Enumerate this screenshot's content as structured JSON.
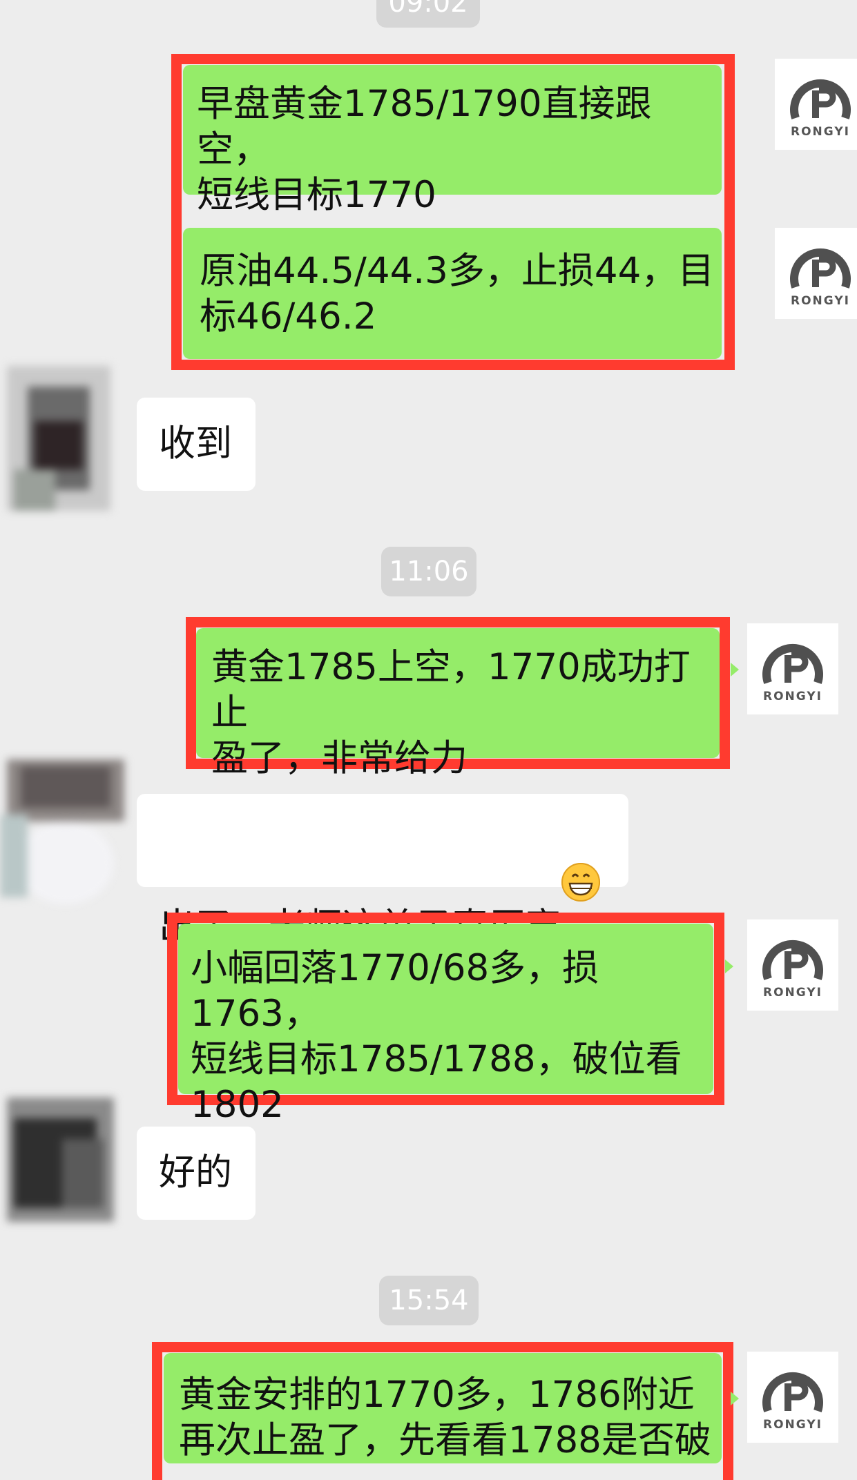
{
  "chat": {
    "timestamps": [
      "09:02",
      "11:06",
      "15:54"
    ],
    "messages": [
      {
        "from": "teacher",
        "text": "早盘黄金1785/1790直接跟空，\n短线目标1770"
      },
      {
        "from": "teacher",
        "text": "原油44.5/44.3多，止损44，目\n标46/46.2"
      },
      {
        "from": "client",
        "text": "收到"
      },
      {
        "from": "teacher",
        "text": "黄金1785上空，1770成功打止\n盈了，非常给力"
      },
      {
        "from": "client",
        "text": "出了，老师这单子真厉害"
      },
      {
        "from": "teacher",
        "text": "小幅回落1770/68多，损1763，\n短线目标1785/1788，破位看\n1802"
      },
      {
        "from": "client",
        "text": "好的"
      },
      {
        "from": "teacher",
        "text": "黄金安排的1770多，1786附近\n再次止盈了，先看看1788是否破"
      }
    ]
  },
  "avatar": {
    "logo_caption": "RONGYI",
    "logo_mark": "融亿",
    "icon": "rongyi-logo-icon"
  },
  "emoji": {
    "icon": "grinning-face-emoji"
  },
  "colors": {
    "background": "#ededed",
    "green_bubble": "#95ec69",
    "highlight_border": "#ff3b2f",
    "white_bubble": "#ffffff"
  }
}
